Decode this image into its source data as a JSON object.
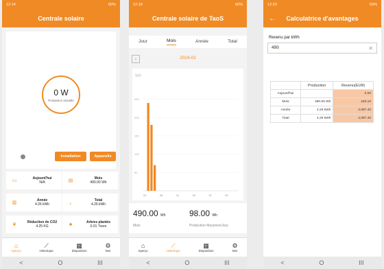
{
  "colors": {
    "accent": "#f08a24",
    "highlight": "#f8c8a5"
  },
  "screen1": {
    "status": {
      "time": "12:14",
      "right": "60%"
    },
    "title": "Centrale solaire",
    "power": {
      "value": "0 W",
      "label": "Puissance actuelle"
    },
    "buttons": {
      "installation": "Installation",
      "devices": "Appareils"
    },
    "stats": [
      {
        "label": "Aujourd'hui",
        "value": "N/A",
        "icon": "calendar-icon"
      },
      {
        "label": "Mois",
        "value": "490.00 Wh",
        "icon": "calendar-month-icon"
      },
      {
        "label": "Année",
        "value": "4.26 kWh",
        "icon": "bar-chart-icon"
      },
      {
        "label": "Total",
        "value": "4.26 kWh",
        "icon": "trend-icon"
      },
      {
        "label": "Réduction de CO2",
        "value": "4.25 KG",
        "icon": "leaf-icon"
      },
      {
        "label": "Arbres plantés",
        "value": "0.01 Trees",
        "icon": "tree-icon"
      }
    ]
  },
  "screen2": {
    "status": {
      "time": "12:16",
      "right": "60%"
    },
    "title": "Centrale solaire de TaoS",
    "tabs": [
      "Jour",
      "Mois",
      "Année",
      "Total"
    ],
    "active_tab": "Mois",
    "period": "2024-02",
    "total": {
      "value": "490.00",
      "unit": "Wh",
      "label": "Mois"
    },
    "average": {
      "value": "98.00",
      "unit": "Wh",
      "label": "Production Moyenne/Jour"
    }
  },
  "screen3": {
    "status": {
      "time": "12:23",
      "right": "59%"
    },
    "title": "Calculatrice d'avantages",
    "back": "←",
    "input_label": "Revenu par kWh",
    "input_value": "490",
    "table": {
      "headers": [
        "",
        "Production",
        "Revenu(EUR)"
      ],
      "rows": [
        [
          "Aujourd'hui",
          "",
          "0.00"
        ],
        [
          "Mois",
          "490.00 Wh",
          "240.10"
        ],
        [
          "Année",
          "4.26 kWh",
          "2,087.40"
        ],
        [
          "Total",
          "4.25 kWh",
          "2,087.40"
        ]
      ]
    }
  },
  "nav": {
    "items": [
      "Aperçu",
      "Historique",
      "Disposition",
      "Moi"
    ]
  },
  "sysnav": [
    "<",
    "O",
    "III"
  ],
  "chart_data": {
    "type": "bar",
    "ylabel": "Wh",
    "ylim": [
      0,
      300
    ],
    "yticks": [
      50,
      100,
      150,
      200,
      250
    ],
    "xticks": [
      "01",
      "06",
      "11",
      "16",
      "21",
      "26"
    ],
    "x": [
      1,
      2,
      3,
      4,
      5,
      6,
      7,
      8,
      9,
      10,
      11,
      12,
      13,
      14,
      15,
      16,
      17,
      18,
      19,
      20,
      21,
      22,
      23,
      24,
      25,
      26,
      27,
      28,
      29
    ],
    "values": [
      0,
      240,
      180,
      70,
      0,
      0,
      0,
      0,
      0,
      0,
      0,
      0,
      0,
      0,
      0,
      0,
      0,
      0,
      0,
      0,
      0,
      0,
      0,
      0,
      0,
      0,
      0,
      0,
      0
    ]
  }
}
